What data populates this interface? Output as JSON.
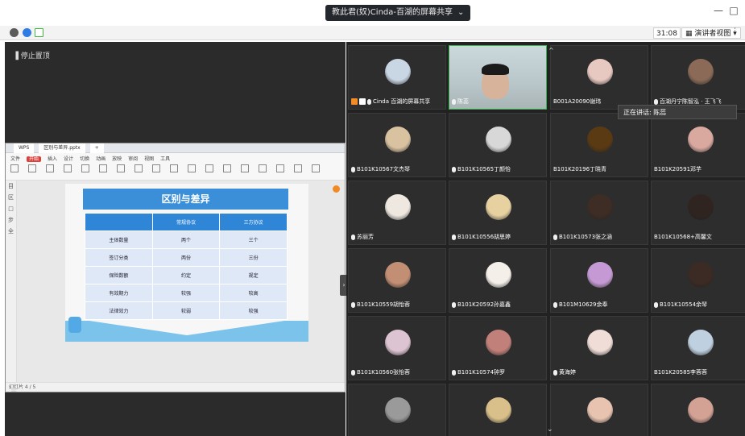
{
  "window": {
    "title": "教此君(奴)Cinda-百湖的屏幕共享",
    "menu_glyph": "⌄",
    "minimize": "—",
    "maximize": "□"
  },
  "toolbar": {
    "timer": "31:08",
    "view_label": "演讲者视图",
    "view_arrow": "▾",
    "more": "⋮"
  },
  "share": {
    "stop_label": "停止置顶",
    "pin_icon": "pin-icon",
    "handle": "›",
    "list_icon": "≡"
  },
  "shared_window": {
    "tabs": [
      "WPS",
      "区别与差异.pptx",
      "+"
    ],
    "menu_items": [
      "文件",
      "开始",
      "插入",
      "设计",
      "切换",
      "动画",
      "放映",
      "审阅",
      "视图",
      "工具"
    ],
    "active_menu": "开始",
    "left_panel": [
      "目",
      "区",
      "□",
      "步",
      "全"
    ],
    "slide_title": "区别与差异",
    "table_headers": [
      "",
      "常规协议",
      "三方协议"
    ],
    "table_rows": [
      [
        "主体数量",
        "两个",
        "三个"
      ],
      [
        "签订分类",
        "两份",
        "三份"
      ],
      [
        "保险数额",
        "约定",
        "规定"
      ],
      [
        "有效期力",
        "较强",
        "较高"
      ],
      [
        "法律效力",
        "较弱",
        "较强"
      ]
    ],
    "status": "幻灯片 4 / 5"
  },
  "tooltip": "正在讲话: 陈蕊",
  "participants": [
    {
      "name": "Cinda 百湖的屏幕共享",
      "kind": "avatar",
      "color": "#c9d6e4",
      "badges": true
    },
    {
      "name": "陈蕊",
      "kind": "video",
      "color": "#c9d6da"
    },
    {
      "name": "B001A20090谢玮",
      "kind": "avatar",
      "color": "#e8c9c1",
      "muted": true
    },
    {
      "name": "百湖丹宁陈智泓 · 王飞飞",
      "kind": "avatar",
      "color": "#8b6b57"
    },
    {
      "name": "B101K10567文杰琴",
      "kind": "avatar",
      "color": "#d9c2a0"
    },
    {
      "name": "B101K10565丁颜怡",
      "kind": "avatar",
      "color": "#d8d8d8"
    },
    {
      "name": "B101K20196丁晓青",
      "kind": "avatar",
      "color": "#5a3a12",
      "muted": true
    },
    {
      "name": "B101K20591邓芋",
      "kind": "avatar",
      "color": "#d9a9a0",
      "muted": true
    },
    {
      "name": "苏丽芳",
      "kind": "avatar",
      "color": "#efe8e0"
    },
    {
      "name": "B101K10556胡思婷",
      "kind": "avatar",
      "color": "#e7d1a0"
    },
    {
      "name": "B101K10573张之涵",
      "kind": "avatar",
      "color": "#3d2d24"
    },
    {
      "name": "B101K10568+高馨文",
      "kind": "avatar",
      "color": "#2f2420",
      "muted": true
    },
    {
      "name": "B101K10559胡怡蓉",
      "kind": "avatar",
      "color": "#c28f74"
    },
    {
      "name": "B101K20592孙嘉鑫",
      "kind": "avatar",
      "color": "#f4efe9"
    },
    {
      "name": "B101M10629余奉",
      "kind": "avatar",
      "color": "#c59ad4"
    },
    {
      "name": "B101K10554余琴",
      "kind": "avatar",
      "color": "#3b2b24"
    },
    {
      "name": "B101K10560张怡蓉",
      "kind": "avatar",
      "color": "#ddc4d2"
    },
    {
      "name": "B101K10574钟罗",
      "kind": "avatar",
      "color": "#c2807a"
    },
    {
      "name": "黄海婷",
      "kind": "avatar",
      "color": "#f0ddd8"
    },
    {
      "name": "B101K20585李蓉蓉",
      "kind": "avatar",
      "color": "#bfd0e0",
      "muted": true
    },
    {
      "name": "",
      "kind": "avatar",
      "color": "#9a9a9a"
    },
    {
      "name": "",
      "kind": "avatar",
      "color": "#d9c08a"
    },
    {
      "name": "",
      "kind": "avatar",
      "color": "#e8c4b0"
    },
    {
      "name": "",
      "kind": "avatar",
      "color": "#d4a295"
    }
  ],
  "grid_nav": {
    "down": "⌄",
    "up": "^"
  }
}
